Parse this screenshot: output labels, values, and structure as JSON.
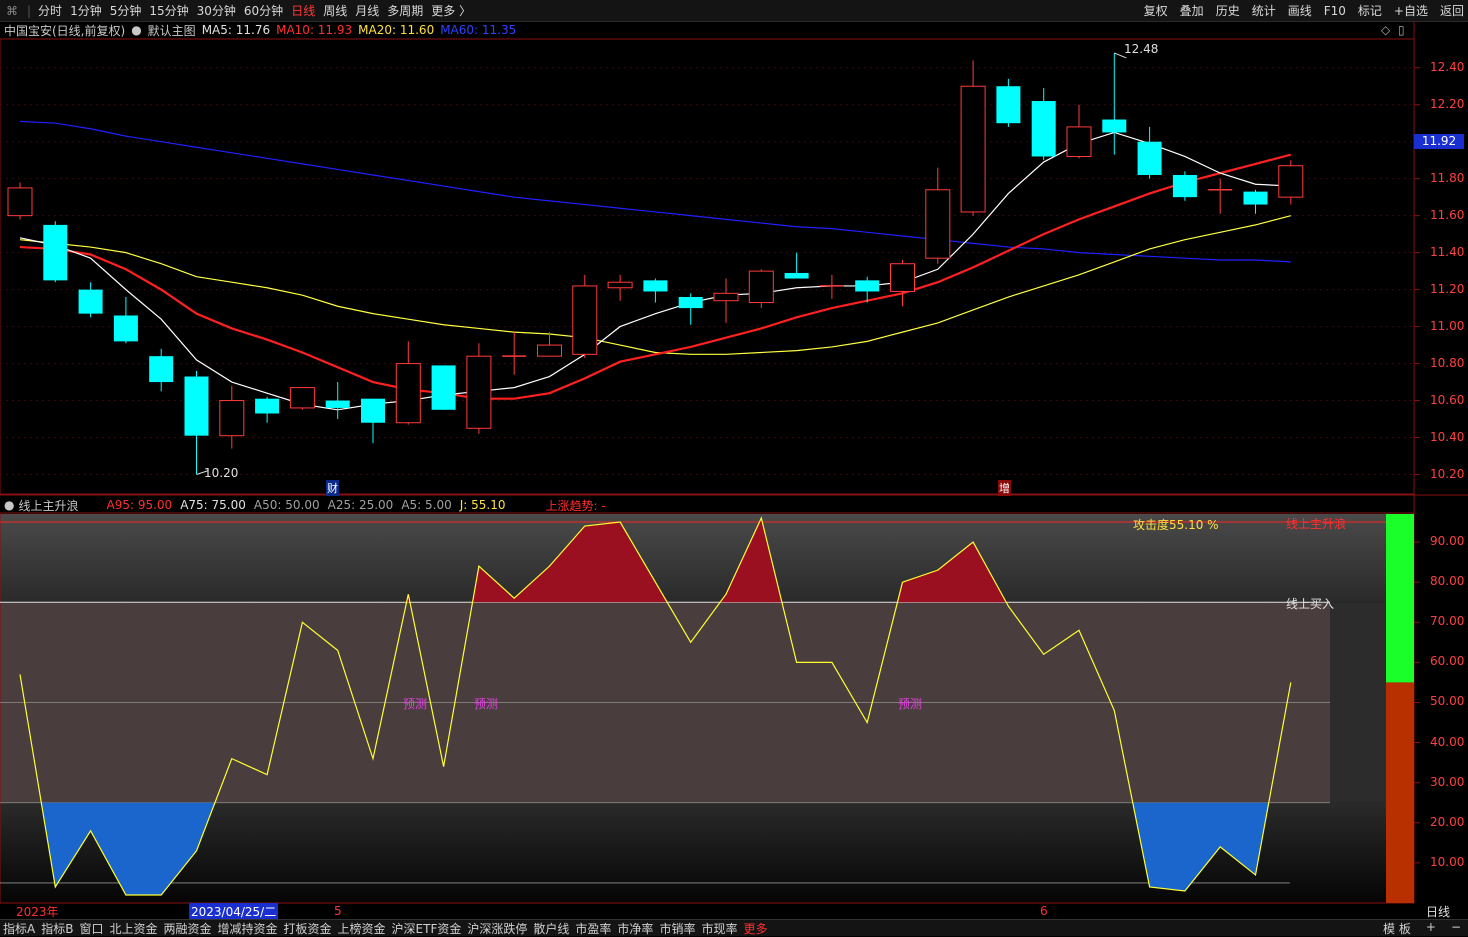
{
  "toolbar": {
    "periods": [
      "分时",
      "1分钟",
      "5分钟",
      "15分钟",
      "30分钟",
      "60分钟",
      "日线",
      "周线",
      "月线",
      "多周期",
      "更多 〉"
    ],
    "active_period": "日线",
    "right_items": [
      "复权",
      "叠加",
      "历史",
      "统计",
      "画线",
      "F10",
      "标记",
      "+自选",
      "返回"
    ]
  },
  "main": {
    "stock_name": "中国宝安(日线,前复权)",
    "template": "默认主图",
    "ma5": "MA5: 11.76",
    "ma10": "MA10: 11.93",
    "ma20": "MA20: 11.60",
    "ma60": "MA60: 11.35",
    "price_ticks": [
      "12.40",
      "12.20",
      "12.00",
      "11.80",
      "11.60",
      "11.40",
      "11.20",
      "11.00",
      "10.80",
      "10.60",
      "10.40",
      "10.20"
    ],
    "current_price": "11.92",
    "high_label": "12.48",
    "low_label": "10.20",
    "event_fin": "财",
    "event_add": "增",
    "colors": {
      "up": "#ff3b3b",
      "down": "#00ffff",
      "ma5": "#ffffff",
      "ma10": "#ff2020",
      "ma20": "#ffff40",
      "ma60": "#2020ff"
    }
  },
  "indicator": {
    "name": "线上主升浪",
    "a95": "A95: 95.00",
    "a75": "A75: 75.00",
    "a50": "A50: 50.00",
    "a25": "A25: 25.00",
    "a5": "A5: 5.00",
    "j": "J: 55.10",
    "trend": "上涨趋势: -",
    "attack": "攻击度55.10 %",
    "label_top": "线上主升浪",
    "label_buy": "线上买入",
    "predict": "预测",
    "ticks": [
      "90.00",
      "80.00",
      "70.00",
      "60.00",
      "50.00",
      "40.00",
      "30.00",
      "20.00",
      "10.00"
    ]
  },
  "dates": {
    "year": "2023年",
    "cursor": "2023/04/25/二",
    "m5": "5",
    "m6": "6",
    "period_label": "日线"
  },
  "bottom": {
    "items": [
      "指标A",
      "指标B",
      "窗口",
      "北上资金",
      "两融资金",
      "增减持资金",
      "打板资金",
      "上榜资金",
      "沪深ETF资金",
      "沪深涨跌停",
      "散户线",
      "市盈率",
      "市净率",
      "市销率",
      "市现率",
      "更多"
    ],
    "right_items": [
      "模 板",
      "+",
      "−"
    ]
  },
  "chart_data": [
    {
      "type": "candlestick",
      "title": "中国宝安(日线,前复权)",
      "ylim": [
        10.1,
        12.55
      ],
      "candles": [
        {
          "o": 11.6,
          "c": 11.75,
          "h": 11.78,
          "l": 11.58
        },
        {
          "o": 11.55,
          "c": 11.25,
          "h": 11.57,
          "l": 11.24
        },
        {
          "o": 11.2,
          "c": 11.07,
          "h": 11.24,
          "l": 11.05
        },
        {
          "o": 11.06,
          "c": 10.92,
          "h": 11.16,
          "l": 10.91
        },
        {
          "o": 10.84,
          "c": 10.7,
          "h": 10.88,
          "l": 10.65
        },
        {
          "o": 10.73,
          "c": 10.41,
          "h": 10.76,
          "l": 10.2
        },
        {
          "o": 10.41,
          "c": 10.6,
          "h": 10.68,
          "l": 10.34
        },
        {
          "o": 10.61,
          "c": 10.53,
          "h": 10.62,
          "l": 10.48
        },
        {
          "o": 10.56,
          "c": 10.67,
          "h": 10.67,
          "l": 10.55
        },
        {
          "o": 10.6,
          "c": 10.56,
          "h": 10.7,
          "l": 10.5
        },
        {
          "o": 10.61,
          "c": 10.48,
          "h": 10.61,
          "l": 10.37
        },
        {
          "o": 10.48,
          "c": 10.8,
          "h": 10.92,
          "l": 10.47
        },
        {
          "o": 10.79,
          "c": 10.55,
          "h": 10.79,
          "l": 10.55
        },
        {
          "o": 10.45,
          "c": 10.84,
          "h": 10.91,
          "l": 10.42
        },
        {
          "o": 10.84,
          "c": 10.84,
          "h": 10.97,
          "l": 10.74
        },
        {
          "o": 10.84,
          "c": 10.9,
          "h": 10.97,
          "l": 10.84
        },
        {
          "o": 10.85,
          "c": 11.22,
          "h": 11.28,
          "l": 10.83
        },
        {
          "o": 11.21,
          "c": 11.24,
          "h": 11.28,
          "l": 11.14
        },
        {
          "o": 11.25,
          "c": 11.19,
          "h": 11.26,
          "l": 11.13
        },
        {
          "o": 11.16,
          "c": 11.1,
          "h": 11.18,
          "l": 11.01
        },
        {
          "o": 11.14,
          "c": 11.18,
          "h": 11.26,
          "l": 11.02
        },
        {
          "o": 11.13,
          "c": 11.3,
          "h": 11.31,
          "l": 11.1
        },
        {
          "o": 11.29,
          "c": 11.26,
          "h": 11.4,
          "l": 11.26
        },
        {
          "o": 11.22,
          "c": 11.22,
          "h": 11.28,
          "l": 11.15
        },
        {
          "o": 11.25,
          "c": 11.19,
          "h": 11.27,
          "l": 11.13
        },
        {
          "o": 11.19,
          "c": 11.34,
          "h": 11.36,
          "l": 11.11
        },
        {
          "o": 11.37,
          "c": 11.74,
          "h": 11.86,
          "l": 11.34
        },
        {
          "o": 11.62,
          "c": 12.3,
          "h": 12.44,
          "l": 11.6
        },
        {
          "o": 12.3,
          "c": 12.1,
          "h": 12.34,
          "l": 12.08
        },
        {
          "o": 12.22,
          "c": 11.92,
          "h": 12.29,
          "l": 11.9
        },
        {
          "o": 11.92,
          "c": 12.08,
          "h": 12.2,
          "l": 11.91
        },
        {
          "o": 12.12,
          "c": 12.05,
          "h": 12.48,
          "l": 11.93
        },
        {
          "o": 12.0,
          "c": 11.82,
          "h": 12.08,
          "l": 11.8
        },
        {
          "o": 11.82,
          "c": 11.7,
          "h": 11.84,
          "l": 11.68
        },
        {
          "o": 11.74,
          "c": 11.74,
          "h": 11.8,
          "l": 11.61
        },
        {
          "o": 11.73,
          "c": 11.66,
          "h": 11.74,
          "l": 11.61
        },
        {
          "o": 11.7,
          "c": 11.87,
          "h": 11.9,
          "l": 11.66
        }
      ],
      "series": [
        {
          "name": "MA5",
          "values": [
            11.48,
            11.44,
            11.37,
            11.2,
            11.04,
            10.82,
            10.7,
            10.64,
            10.58,
            10.55,
            10.58,
            10.6,
            10.63,
            10.65,
            10.67,
            10.73,
            10.85,
            11.0,
            11.07,
            11.13,
            11.17,
            11.18,
            11.21,
            11.22,
            11.22,
            11.24,
            11.31,
            11.5,
            11.72,
            11.89,
            11.99,
            12.05,
            11.99,
            11.92,
            11.83,
            11.77,
            11.76
          ]
        },
        {
          "name": "MA10",
          "values": [
            11.43,
            11.42,
            11.39,
            11.31,
            11.2,
            11.07,
            10.99,
            10.93,
            10.86,
            10.78,
            10.7,
            10.66,
            10.64,
            10.61,
            10.61,
            10.64,
            10.72,
            10.81,
            10.85,
            10.89,
            10.94,
            10.99,
            11.05,
            11.1,
            11.14,
            11.18,
            11.24,
            11.32,
            11.41,
            11.5,
            11.58,
            11.65,
            11.72,
            11.78,
            11.83,
            11.88,
            11.93
          ]
        },
        {
          "name": "MA20",
          "values": [
            11.47,
            11.45,
            11.43,
            11.4,
            11.34,
            11.27,
            11.24,
            11.21,
            11.17,
            11.11,
            11.07,
            11.04,
            11.01,
            10.99,
            10.97,
            10.96,
            10.94,
            10.9,
            10.86,
            10.85,
            10.85,
            10.86,
            10.87,
            10.89,
            10.92,
            10.97,
            11.02,
            11.09,
            11.16,
            11.22,
            11.28,
            11.35,
            11.42,
            11.47,
            11.51,
            11.55,
            11.6
          ]
        },
        {
          "name": "MA60",
          "values": [
            12.11,
            12.1,
            12.07,
            12.03,
            12.0,
            11.97,
            11.94,
            11.91,
            11.88,
            11.85,
            11.82,
            11.79,
            11.76,
            11.73,
            11.7,
            11.68,
            11.66,
            11.64,
            11.62,
            11.6,
            11.58,
            11.56,
            11.54,
            11.53,
            11.51,
            11.49,
            11.47,
            11.45,
            11.43,
            11.42,
            11.4,
            11.39,
            11.38,
            11.37,
            11.36,
            11.36,
            11.35
          ]
        }
      ]
    },
    {
      "type": "line",
      "title": "线上主升浪",
      "ylim": [
        0,
        97
      ],
      "series": [
        {
          "name": "J",
          "values": [
            57,
            4,
            18,
            2,
            2,
            13,
            36,
            32,
            70,
            63,
            36,
            77,
            34,
            84,
            76,
            84,
            94,
            95,
            80,
            65,
            77,
            96,
            60,
            60,
            45,
            80,
            83,
            90,
            74,
            62,
            68,
            48,
            4,
            3,
            14,
            7,
            55
          ]
        }
      ]
    }
  ]
}
